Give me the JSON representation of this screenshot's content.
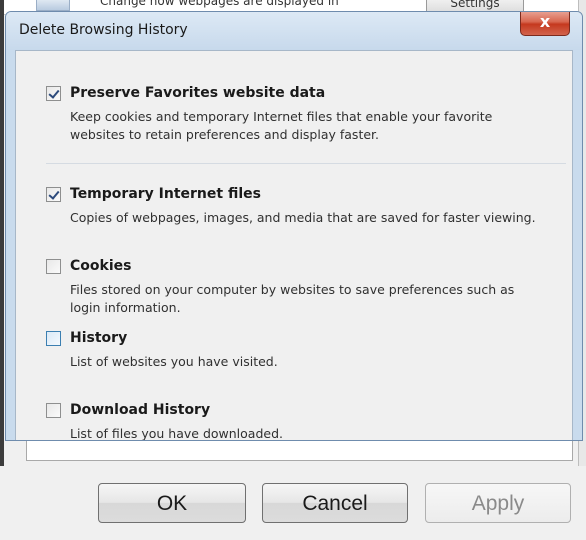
{
  "background_window": {
    "top_text": "Change how webpages are displayed in",
    "top_button": "Settings",
    "buttons": {
      "ok": "OK",
      "cancel": "Cancel",
      "apply": "Apply"
    }
  },
  "dialog": {
    "title": "Delete Browsing History",
    "close_glyph": "x",
    "options": [
      {
        "label": "Preserve Favorites website data",
        "checked": true,
        "description": "Keep cookies and temporary Internet files that enable your favorite websites to retain preferences and display faster."
      },
      {
        "label": "Temporary Internet files",
        "checked": true,
        "description": "Copies of webpages, images, and media that are saved for faster viewing."
      },
      {
        "label": "Cookies",
        "checked": false,
        "description": "Files stored on your computer by websites to save preferences such as login information."
      },
      {
        "label": "History",
        "checked": false,
        "description": "List of websites you have visited."
      },
      {
        "label": "Download History",
        "checked": false,
        "description": "List of files you have downloaded."
      }
    ]
  },
  "colors": {
    "close_button": "#c5391f",
    "dialog_frame": "#c9dbed",
    "content_bg": "#f0f0f0"
  }
}
